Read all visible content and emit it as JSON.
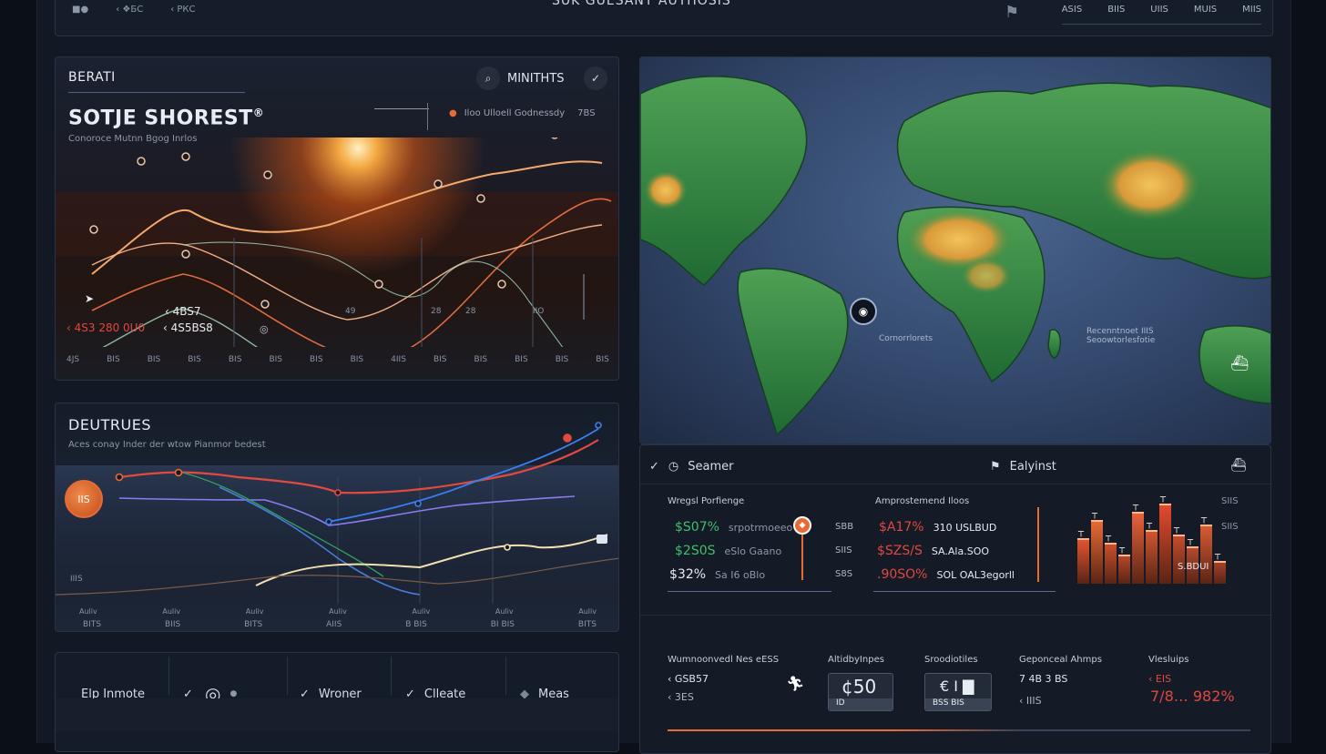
{
  "topbar": {
    "left_items": [
      "■●",
      "‹ ❖БС",
      "‹ РКС"
    ],
    "center_title": "SUK GUESANT AUTHOSIS",
    "right_items": [
      "ASIS",
      "BIIS",
      "UIIS",
      "MUIS",
      "MIIS"
    ]
  },
  "p1": {
    "kicker": "BERATI",
    "title": "SOTJE SHOREST",
    "title_mark": "®",
    "subtitle": "Conoroce Mutnn Bgog Inrlos",
    "search_label": "MINITHTS",
    "legend_text": "Iloo Ulloell Godnessdy",
    "legend_value": "7BS",
    "stat1_label": "‹ 4BS7",
    "stat1_value": "‹ 4S3 280 0U0",
    "stat2_value": "‹ 4S5BS8",
    "inline_labels": [
      "49",
      "28",
      "28",
      "IIO"
    ],
    "axis_x": [
      "4JS",
      "BIS",
      "BIS",
      "BIS",
      "BIS",
      "BIS",
      "BIS",
      "BIS",
      "4IIS",
      "BIS",
      "BIS",
      "BIS",
      "BIS",
      "BIS"
    ]
  },
  "p2": {
    "title": "DEUTRUES",
    "subtitle": "Aces conay Inder der wtow Pianmor bedest",
    "badge": "IIS",
    "y_label": "IIIS",
    "axis_top": [
      "Auliv",
      "Auliv",
      "Auliv",
      "Auliv",
      "Auliv",
      "Auliv",
      "Auliv"
    ],
    "axis_bottom": [
      "BITS",
      "BIIS",
      "BITS",
      "AIIS",
      "B BIS",
      "BI BIS",
      "BITS"
    ]
  },
  "p3": {
    "tabs": [
      {
        "icon": "",
        "label": "Elp Inmote"
      },
      {
        "icon": "✓",
        "label": ""
      },
      {
        "icon": "◎",
        "label": ""
      },
      {
        "icon": "✓",
        "label": "Wroner"
      },
      {
        "icon": "✓",
        "label": "Clleate"
      },
      {
        "icon": "◆",
        "label": "Meas"
      }
    ]
  },
  "p4": {
    "map_label1": "Cornorrlorets",
    "map_label2": "Recenntnoet IIIS\nSeoowtorlesfotie",
    "pin_icon": "location-pin"
  },
  "p5": {
    "header_left": "Seamer",
    "header_center": "Ealyinst",
    "block1": {
      "title": "Wregsl Porfienge",
      "rows": [
        {
          "value": "$S07%",
          "text": "srpotrmoeeo",
          "cls": "green"
        },
        {
          "value": "$2S0S",
          "text": "eSlo Gaano",
          "cls": "green"
        },
        {
          "value": "$32%",
          "text": "Sa I6 oBlo",
          "cls": "white"
        }
      ],
      "right": [
        "SBB",
        "SIIS",
        "S8S"
      ]
    },
    "block2": {
      "title": "Amprostemend Iloos",
      "rows": [
        {
          "value": "$A17%",
          "text": "310 USLBUD",
          "cls": "red"
        },
        {
          "value": "$SZS/S",
          "text": "SA.Ala.SOO",
          "cls": "red"
        },
        {
          "value": ".90SO%",
          "text": "SOL OAL3egorll",
          "cls": "red"
        }
      ]
    },
    "bar_labels": {
      "right1": "SIIS",
      "right2": "SIIS",
      "bottom": "S.BDUI"
    },
    "bars": [
      {
        "value": 0.55,
        "color": "#e3542f"
      },
      {
        "value": 0.78,
        "color": "#e86a35"
      },
      {
        "value": 0.5,
        "color": "#c8502c"
      },
      {
        "value": 0.36,
        "color": "#b3472a"
      },
      {
        "value": 0.88,
        "color": "#e8623a"
      },
      {
        "value": 0.65,
        "color": "#cf5530"
      },
      {
        "value": 0.98,
        "color": "#e24a2e"
      },
      {
        "value": 0.6,
        "color": "#c44d2c"
      },
      {
        "value": 0.45,
        "color": "#b24a30"
      },
      {
        "value": 0.72,
        "color": "#d85b33"
      },
      {
        "value": 0.28,
        "color": "#a44128"
      }
    ],
    "kpis": [
      {
        "title": "Wumnoonvedl Nes eESS",
        "l1": "‹ GSB57",
        "l2": "‹ 3ES"
      },
      {
        "title": "AltidbyInpes",
        "big": "¢50",
        "small": "ID"
      },
      {
        "title": "Sroodiotiles",
        "big": "€ I ▇",
        "small": "BSS BIS"
      },
      {
        "title": "Geponceal Ahmps",
        "l1": "7 4B 3 BS",
        "l2": "‹ IIIS"
      },
      {
        "title": "Vlesluips",
        "l1": "‹ EIS",
        "big": "7/8… 982%"
      }
    ]
  }
}
